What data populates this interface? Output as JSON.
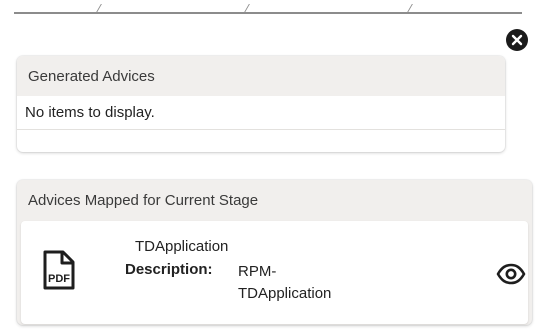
{
  "dialog": {
    "close_icon": "close-circle-icon"
  },
  "generated_advices": {
    "title": "Generated Advices",
    "empty_text": "No items to display."
  },
  "mapped_advices": {
    "title": "Advices Mapped for Current Stage",
    "items": [
      {
        "icon": "pdf-file-icon",
        "icon_text": "PDF",
        "name": "TDApplication",
        "description_label": "Description:",
        "description_line1": "RPM-",
        "description_line2": "TDApplication",
        "action_icon": "eye-icon"
      }
    ]
  }
}
